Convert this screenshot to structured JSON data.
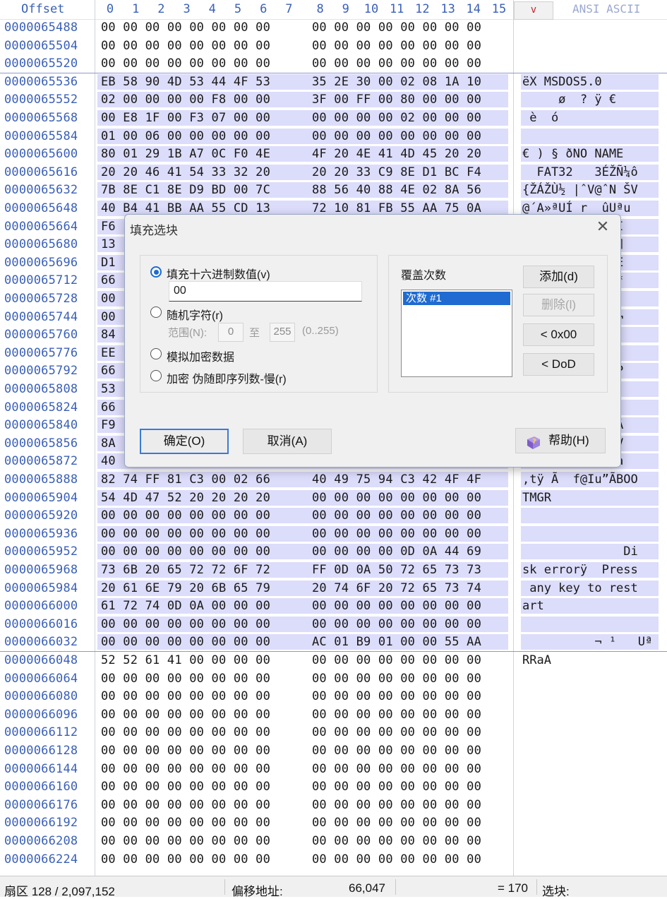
{
  "header": {
    "offset_label": "Offset",
    "hex_columns": [
      "0",
      "1",
      "2",
      "3",
      "4",
      "5",
      "6",
      "7",
      "8",
      "9",
      "10",
      "11",
      "12",
      "13",
      "14",
      "15"
    ],
    "sort_button": "v",
    "ansi_label": "ANSI ASCII"
  },
  "rows": [
    {
      "offset": "0000065488",
      "a": "00 00 00 00 00 00 00 00",
      "b": "00 00 00 00 00 00 00 00",
      "ansi": "",
      "sel": false
    },
    {
      "offset": "0000065504",
      "a": "00 00 00 00 00 00 00 00",
      "b": "00 00 00 00 00 00 00 00",
      "ansi": "",
      "sel": false
    },
    {
      "offset": "0000065520",
      "a": "00 00 00 00 00 00 00 00",
      "b": "00 00 00 00 00 00 00 00",
      "ansi": "",
      "sel": false
    },
    {
      "offset": "0000065536",
      "a": "EB 58 90 4D 53 44 4F 53",
      "b": "35 2E 30 00 02 08 1A 10",
      "ansi": "ëX MSDOS5.0",
      "sel": true
    },
    {
      "offset": "0000065552",
      "a": "02 00 00 00 00 F8 00 00",
      "b": "3F 00 FF 00 80 00 00 00",
      "ansi": "     ø  ? ÿ €",
      "sel": true
    },
    {
      "offset": "0000065568",
      "a": "00 E8 1F 00 F3 07 00 00",
      "b": "00 00 00 00 02 00 00 00",
      "ansi": " è  ó",
      "sel": true
    },
    {
      "offset": "0000065584",
      "a": "01 00 06 00 00 00 00 00",
      "b": "00 00 00 00 00 00 00 00",
      "ansi": "",
      "sel": true
    },
    {
      "offset": "0000065600",
      "a": "80 01 29 1B A7 0C F0 4E",
      "b": "4F 20 4E 41 4D 45 20 20",
      "ansi": "€ ) § ðNO NAME",
      "sel": true
    },
    {
      "offset": "0000065616",
      "a": "20 20 46 41 54 33 32 20",
      "b": "20 20 33 C9 8E D1 BC F4",
      "ansi": "  FAT32   3ÉŽÑ¼ô",
      "sel": true
    },
    {
      "offset": "0000065632",
      "a": "7B 8E C1 8E D9 BD 00 7C",
      "b": "88 56 40 88 4E 02 8A 56",
      "ansi": "{ŽÁŽÙ½ |ˆV@ˆN ŠV",
      "sel": true
    },
    {
      "offset": "0000065648",
      "a": "40 B4 41 BB AA 55 CD 13",
      "b": "72 10 81 FB 55 AA 75 0A",
      "ansi": "@´A»ªUÍ r  ûUªu",
      "sel": true
    },
    {
      "offset": "0000065664",
      "a": "F6",
      "b": "",
      "ansi": "         7@´ Í",
      "sel": true
    },
    {
      "offset": "0000065680",
      "a": "13",
      "b": "",
      "ansi": "         €@f ¶",
      "sel": true
    },
    {
      "offset": "0000065696",
      "a": "D1",
      "b": "",
      "ansi": "         Af ·É",
      "sel": true
    },
    {
      "offset": "0000065712",
      "a": "66",
      "b": "",
      "ansi": "         ‰9f~*",
      "sel": true
    },
    {
      "offset": "0000065728",
      "a": "00",
      "b": "",
      "ansi": "         › €¹",
      "sel": true
    },
    {
      "offset": "0000065744",
      "a": "00",
      "b": "",
      "ansi": "         Â|<ð¬",
      "sel": true
    },
    {
      "offset": "0000065760",
      "a": "84",
      "b": "",
      "ansi": "          í ë",
      "sel": true
    },
    {
      "offset": "0000065776",
      "a": "EE",
      "b": "",
      "ansi": "         ¯í í",
      "sel": true
    },
    {
      "offset": "0000065792",
      "a": "66",
      "b": "",
      "ansi": "          j fP",
      "sel": true
    },
    {
      "offset": "0000065808",
      "a": "53",
      "b": "",
      "ansi": "         ê<ôÍ",
      "sel": true
    },
    {
      "offset": "0000065824",
      "a": "66",
      "b": "",
      "ansi": "         ;Før",
      "sel": true
    },
    {
      "offset": "0000065840",
      "a": "F9",
      "b": "",
      "ansi": "         Ì÷ñþÂ",
      "sel": true
    },
    {
      "offset": "0000065856",
      "a": "8A",
      "b": "",
      "ansi": "          †öšV",
      "sel": true
    },
    {
      "offset": "0000065872",
      "a": "40",
      "b": "",
      "ansi": "          Í fa",
      "sel": true
    },
    {
      "offset": "0000065888",
      "a": "82 74 FF 81 C3 00 02 66",
      "b": "40 49 75 94 C3 42 4F 4F",
      "ansi": ",tÿ Ã  f@Iu”ÃBOO",
      "sel": true
    },
    {
      "offset": "0000065904",
      "a": "54 4D 47 52 20 20 20 20",
      "b": "00 00 00 00 00 00 00 00",
      "ansi": "TMGR",
      "sel": true
    },
    {
      "offset": "0000065920",
      "a": "00 00 00 00 00 00 00 00",
      "b": "00 00 00 00 00 00 00 00",
      "ansi": "",
      "sel": true
    },
    {
      "offset": "0000065936",
      "a": "00 00 00 00 00 00 00 00",
      "b": "00 00 00 00 00 00 00 00",
      "ansi": "",
      "sel": true
    },
    {
      "offset": "0000065952",
      "a": "00 00 00 00 00 00 00 00",
      "b": "00 00 00 00 0D 0A 44 69",
      "ansi": "              Di",
      "sel": true
    },
    {
      "offset": "0000065968",
      "a": "73 6B 20 65 72 72 6F 72",
      "b": "FF 0D 0A 50 72 65 73 73",
      "ansi": "sk errorÿ  Press",
      "sel": true
    },
    {
      "offset": "0000065984",
      "a": "20 61 6E 79 20 6B 65 79",
      "b": "20 74 6F 20 72 65 73 74",
      "ansi": " any key to rest",
      "sel": true
    },
    {
      "offset": "0000066000",
      "a": "61 72 74 0D 0A 00 00 00",
      "b": "00 00 00 00 00 00 00 00",
      "ansi": "art",
      "sel": true
    },
    {
      "offset": "0000066016",
      "a": "00 00 00 00 00 00 00 00",
      "b": "00 00 00 00 00 00 00 00",
      "ansi": "",
      "sel": true
    },
    {
      "offset": "0000066032",
      "a": "00 00 00 00 00 00 00 00",
      "b": "AC 01 B9 01 00 00 55 AA",
      "ansi": "          ¬ ¹   Uª",
      "sel": true
    },
    {
      "offset": "0000066048",
      "a": "52 52 61 41 00 00 00 00",
      "b": "00 00 00 00 00 00 00 00",
      "ansi": "RRaA",
      "sel": false
    },
    {
      "offset": "0000066064",
      "a": "00 00 00 00 00 00 00 00",
      "b": "00 00 00 00 00 00 00 00",
      "ansi": "",
      "sel": false
    },
    {
      "offset": "0000066080",
      "a": "00 00 00 00 00 00 00 00",
      "b": "00 00 00 00 00 00 00 00",
      "ansi": "",
      "sel": false
    },
    {
      "offset": "0000066096",
      "a": "00 00 00 00 00 00 00 00",
      "b": "00 00 00 00 00 00 00 00",
      "ansi": "",
      "sel": false
    },
    {
      "offset": "0000066112",
      "a": "00 00 00 00 00 00 00 00",
      "b": "00 00 00 00 00 00 00 00",
      "ansi": "",
      "sel": false
    },
    {
      "offset": "0000066128",
      "a": "00 00 00 00 00 00 00 00",
      "b": "00 00 00 00 00 00 00 00",
      "ansi": "",
      "sel": false
    },
    {
      "offset": "0000066144",
      "a": "00 00 00 00 00 00 00 00",
      "b": "00 00 00 00 00 00 00 00",
      "ansi": "",
      "sel": false
    },
    {
      "offset": "0000066160",
      "a": "00 00 00 00 00 00 00 00",
      "b": "00 00 00 00 00 00 00 00",
      "ansi": "",
      "sel": false
    },
    {
      "offset": "0000066176",
      "a": "00 00 00 00 00 00 00 00",
      "b": "00 00 00 00 00 00 00 00",
      "ansi": "",
      "sel": false
    },
    {
      "offset": "0000066192",
      "a": "00 00 00 00 00 00 00 00",
      "b": "00 00 00 00 00 00 00 00",
      "ansi": "",
      "sel": false
    },
    {
      "offset": "0000066208",
      "a": "00 00 00 00 00 00 00 00",
      "b": "00 00 00 00 00 00 00 00",
      "ansi": "",
      "sel": false
    },
    {
      "offset": "0000066224",
      "a": "00 00 00 00 00 00 00 00",
      "b": "00 00 00 00 00 00 00 00",
      "ansi": "",
      "sel": false
    }
  ],
  "dialog": {
    "title": "填充选块",
    "close": "✕",
    "opt_hex": "填充十六进制数值(v)",
    "hex_value": "00",
    "opt_random": "随机字符(r)",
    "range_label": "范围(N):",
    "range_from": "0",
    "range_to_label": "至",
    "range_to": "255",
    "range_hint": "(0..255)",
    "opt_encrypt_sim": "模拟加密数据",
    "opt_prng": "加密 伪随即序列数-慢(r)",
    "passes_label": "覆盖次数",
    "pass_item": "次数 #1",
    "btn_add": "添加(d)",
    "btn_delete": "删除(l)",
    "btn_0x00": "< 0x00",
    "btn_dod": "< DoD",
    "btn_ok": "确定(O)",
    "btn_cancel": "取消(A)",
    "btn_help": "帮助(H)"
  },
  "statusbar": {
    "sector": "扇区 128 / 2,097,152",
    "offset_label": "偏移地址:",
    "offset_value": "66,047",
    "value": "= 170",
    "selection_label": "选块:"
  },
  "colors": {
    "accent": "#1f6bd1",
    "selection": "#dcdcfb",
    "offset_text": "#3a5fb8"
  }
}
